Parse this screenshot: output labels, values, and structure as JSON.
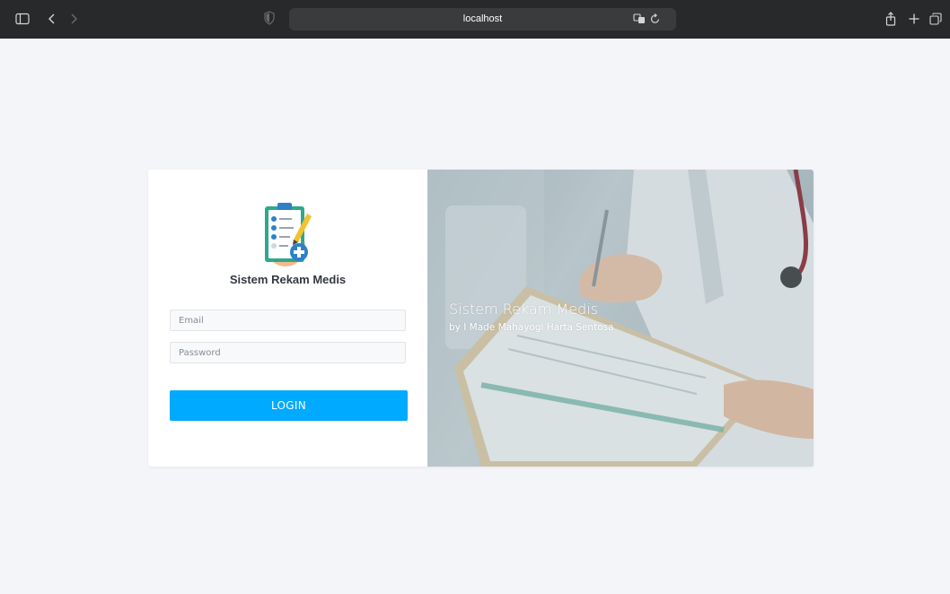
{
  "browser": {
    "address": "localhost",
    "icons": [
      "sidebar-icon",
      "back-icon",
      "forward-icon",
      "shield-icon",
      "translate-icon",
      "reload-icon",
      "share-icon",
      "new-tab-icon",
      "tabs-icon"
    ]
  },
  "login": {
    "app_name": "Sistem Rekam Medis",
    "email_placeholder": "Email",
    "password_placeholder": "Password",
    "login_label": "LOGIN"
  },
  "hero": {
    "title": "Sistem Rekam Medis",
    "subtitle": "by I Made Mahayogi Harta Sentosa"
  },
  "colors": {
    "accent": "#00aaff",
    "toolbar": "#28292b",
    "page_bg": "#f4f5f9"
  }
}
